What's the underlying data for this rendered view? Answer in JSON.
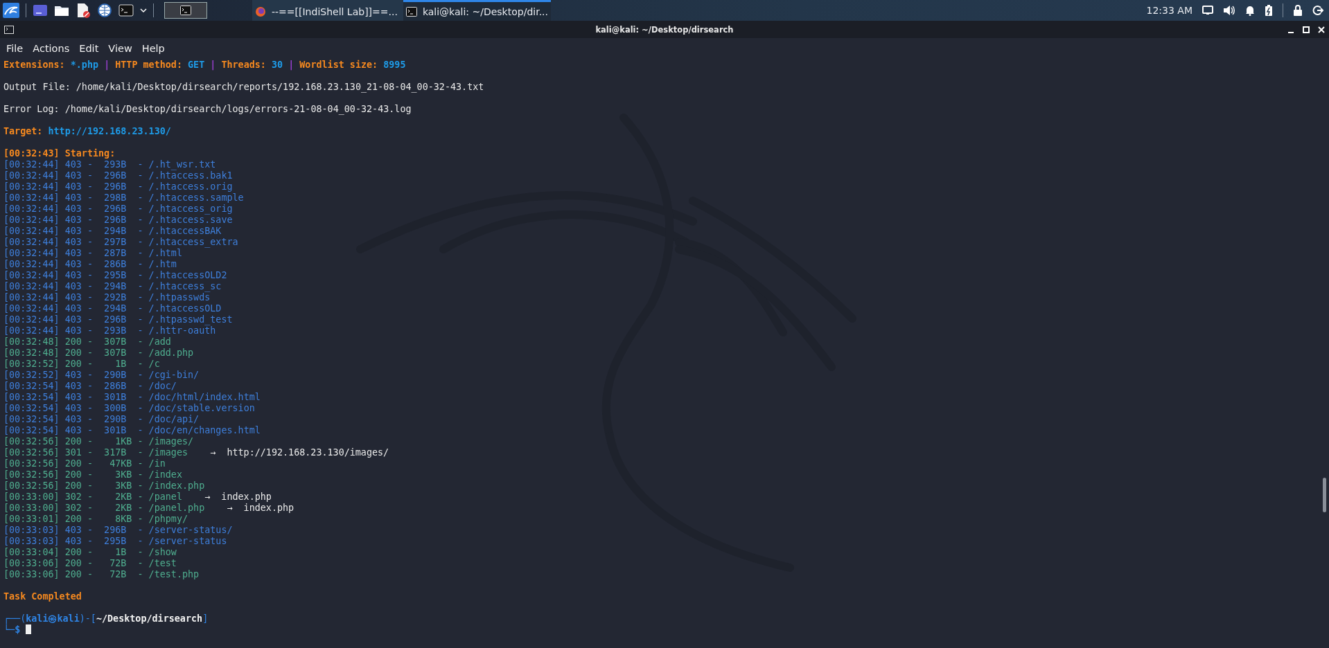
{
  "taskbar": {
    "tasks": [
      {
        "kind": "browser",
        "label": "--==[[IndiShell Lab]]==...",
        "selected": false
      },
      {
        "kind": "terminal",
        "label": "kali@kali: ~/Desktop/dir...",
        "selected": true
      }
    ],
    "clock": "12:33 AM"
  },
  "window": {
    "title": "kali@kali: ~/Desktop/dirsearch"
  },
  "menu": [
    "File",
    "Actions",
    "Edit",
    "View",
    "Help"
  ],
  "header": [
    {
      "kind": "field",
      "label": "Extensions:",
      "value": "*.php"
    },
    {
      "kind": "separator",
      "label": "|"
    },
    {
      "kind": "field",
      "label": "HTTP method:",
      "value": "GET"
    },
    {
      "kind": "separator",
      "label": "|"
    },
    {
      "kind": "field",
      "label": "Threads:",
      "value": "30"
    },
    {
      "kind": "separator",
      "label": "|"
    },
    {
      "kind": "field",
      "label": "Wordlist size:",
      "value": "8995"
    }
  ],
  "output_file": "Output File: /home/kali/Desktop/dirsearch/reports/192.168.23.130_21-08-04_00-32-43.txt",
  "error_log": "Error Log: /home/kali/Desktop/dirsearch/logs/errors-21-08-04_00-32-43.log",
  "target": {
    "label": "Target:",
    "value": "http://192.168.23.130/"
  },
  "starting": "[00:32:43] Starting:",
  "rows": [
    {
      "text": "[00:32:44] 403 -  293B  - /.ht_wsr.txt",
      "color": "#3e7fdb"
    },
    {
      "text": "[00:32:44] 403 -  296B  - /.htaccess.bak1",
      "color": "#3e7fdb"
    },
    {
      "text": "[00:32:44] 403 -  296B  - /.htaccess.orig",
      "color": "#3e7fdb"
    },
    {
      "text": "[00:32:44] 403 -  298B  - /.htaccess.sample",
      "color": "#3e7fdb"
    },
    {
      "text": "[00:32:44] 403 -  296B  - /.htaccess_orig",
      "color": "#3e7fdb"
    },
    {
      "text": "[00:32:44] 403 -  296B  - /.htaccess.save",
      "color": "#3e7fdb"
    },
    {
      "text": "[00:32:44] 403 -  294B  - /.htaccessBAK",
      "color": "#3e7fdb"
    },
    {
      "text": "[00:32:44] 403 -  297B  - /.htaccess_extra",
      "color": "#3e7fdb"
    },
    {
      "text": "[00:32:44] 403 -  287B  - /.html",
      "color": "#3e7fdb"
    },
    {
      "text": "[00:32:44] 403 -  286B  - /.htm",
      "color": "#3e7fdb"
    },
    {
      "text": "[00:32:44] 403 -  295B  - /.htaccessOLD2",
      "color": "#3e7fdb"
    },
    {
      "text": "[00:32:44] 403 -  294B  - /.htaccess_sc",
      "color": "#3e7fdb"
    },
    {
      "text": "[00:32:44] 403 -  292B  - /.htpasswds",
      "color": "#3e7fdb"
    },
    {
      "text": "[00:32:44] 403 -  294B  - /.htaccessOLD",
      "color": "#3e7fdb"
    },
    {
      "text": "[00:32:44] 403 -  296B  - /.htpasswd_test",
      "color": "#3e7fdb"
    },
    {
      "text": "[00:32:44] 403 -  293B  - /.httr-oauth",
      "color": "#3e7fdb"
    },
    {
      "text": "[00:32:48] 200 -  307B  - /add",
      "color": "#4fae8f"
    },
    {
      "text": "[00:32:48] 200 -  307B  - /add.php",
      "color": "#4fae8f"
    },
    {
      "text": "[00:32:52] 200 -    1B  - /c",
      "color": "#4fae8f"
    },
    {
      "text": "[00:32:52] 403 -  290B  - /cgi-bin/",
      "color": "#3e7fdb"
    },
    {
      "text": "[00:32:54] 403 -  286B  - /doc/",
      "color": "#3e7fdb"
    },
    {
      "text": "[00:32:54] 403 -  301B  - /doc/html/index.html",
      "color": "#3e7fdb"
    },
    {
      "text": "[00:32:54] 403 -  300B  - /doc/stable.version",
      "color": "#3e7fdb"
    },
    {
      "text": "[00:32:54] 403 -  290B  - /doc/api/",
      "color": "#3e7fdb"
    },
    {
      "text": "[00:32:54] 403 -  301B  - /doc/en/changes.html",
      "color": "#3e7fdb"
    },
    {
      "text": "[00:32:56] 200 -    1KB - /images/",
      "color": "#4fae8f"
    },
    {
      "text": "[00:32:56] 301 -  317B  - /images",
      "color": "#4fae8f",
      "redirect": "→  http://192.168.23.130/images/"
    },
    {
      "text": "[00:32:56] 200 -   47KB - /in",
      "color": "#4fae8f"
    },
    {
      "text": "[00:32:56] 200 -    3KB - /index",
      "color": "#4fae8f"
    },
    {
      "text": "[00:32:56] 200 -    3KB - /index.php",
      "color": "#4fae8f"
    },
    {
      "text": "[00:33:00] 302 -    2KB - /panel",
      "color": "#4fae8f",
      "redirect": "→  index.php"
    },
    {
      "text": "[00:33:00] 302 -    2KB - /panel.php",
      "color": "#4fae8f",
      "redirect": "→  index.php"
    },
    {
      "text": "[00:33:01] 200 -    8KB - /phpmy/",
      "color": "#4fae8f"
    },
    {
      "text": "[00:33:03] 403 -  296B  - /server-status/",
      "color": "#3e7fdb"
    },
    {
      "text": "[00:33:03] 403 -  295B  - /server-status",
      "color": "#3e7fdb"
    },
    {
      "text": "[00:33:04] 200 -    1B  - /show",
      "color": "#4fae8f"
    },
    {
      "text": "[00:33:06] 200 -   72B  - /test",
      "color": "#4fae8f"
    },
    {
      "text": "[00:33:06] 200 -   72B  - /test.php",
      "color": "#4fae8f"
    }
  ],
  "completed": "Task Completed",
  "prompt": {
    "open": "┌──(",
    "user_host": "kali㉿kali",
    "mid": ")-[",
    "path": "~/Desktop/dirsearch",
    "close": "]",
    "branch": "└─",
    "symbol": "$"
  }
}
